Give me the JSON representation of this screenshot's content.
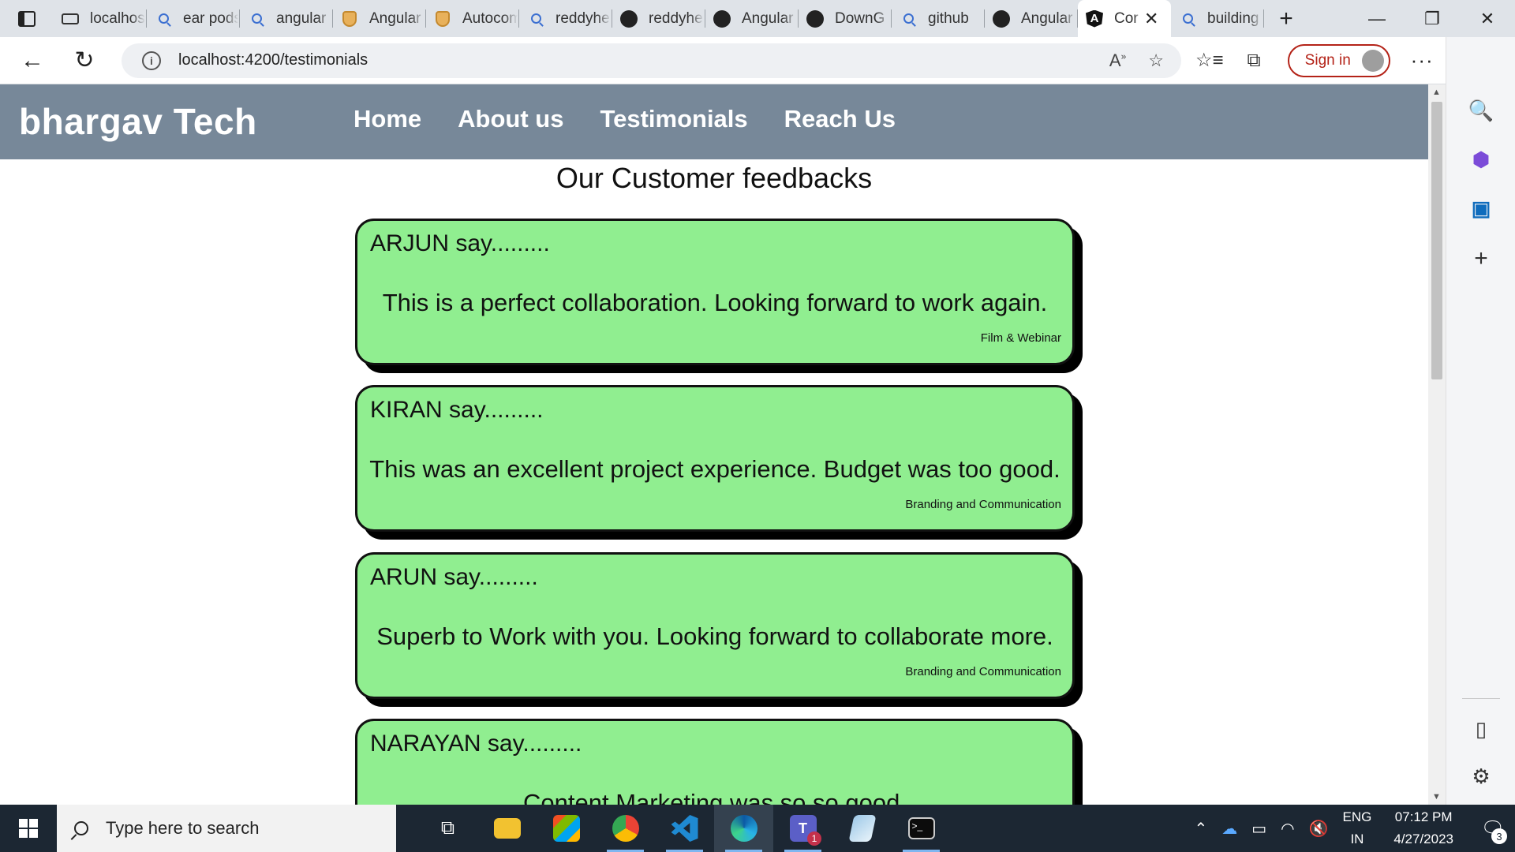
{
  "browser": {
    "tabs": [
      {
        "label": "localhost",
        "icon": "localhost-icon"
      },
      {
        "label": "ear pods",
        "icon": "search-icon"
      },
      {
        "label": "angular",
        "icon": "search-icon"
      },
      {
        "label": "Angular",
        "icon": "shield-icon"
      },
      {
        "label": "Autocomplete",
        "icon": "shield-icon"
      },
      {
        "label": "reddyhe",
        "icon": "search-icon"
      },
      {
        "label": "reddyhe",
        "icon": "github-icon"
      },
      {
        "label": "Angular",
        "icon": "github-icon"
      },
      {
        "label": "DownG",
        "icon": "github-icon"
      },
      {
        "label": "github",
        "icon": "search-icon"
      },
      {
        "label": "Angular",
        "icon": "github-icon"
      },
      {
        "label": "Cor",
        "icon": "angular-icon",
        "active": true
      },
      {
        "label": "building",
        "icon": "search-icon"
      }
    ],
    "url": "localhost:4200/testimonials",
    "sign_in_label": "Sign in"
  },
  "site": {
    "brand": "bhargav Tech",
    "nav": [
      "Home",
      "About us",
      "Testimonials",
      "Reach Us"
    ],
    "heading": "Our Customer feedbacks",
    "testimonials": [
      {
        "author": "ARJUN say.........",
        "message": "This is a perfect collaboration. Looking forward to work again.",
        "category": "Film & Webinar"
      },
      {
        "author": "KIRAN say.........",
        "message": "This was an excellent project experience. Budget was too good.",
        "category": "Branding and Communication"
      },
      {
        "author": "ARUN say.........",
        "message": "Superb to Work with you. Looking forward to collaborate more.",
        "category": "Branding and Communication"
      },
      {
        "author": "NARAYAN say.........",
        "message": "Content Marketing was so so good.",
        "category": ""
      }
    ]
  },
  "taskbar": {
    "search_placeholder": "Type here to search",
    "language_line1": "ENG",
    "language_line2": "IN",
    "time": "07:12 PM",
    "date": "4/27/2023",
    "notification_count": "3",
    "teams_badge": "1"
  },
  "colors": {
    "site_nav_bg": "#778899",
    "card_bg": "#90ee90",
    "taskbar_bg": "#1c2733",
    "signin_accent": "#b42318"
  }
}
